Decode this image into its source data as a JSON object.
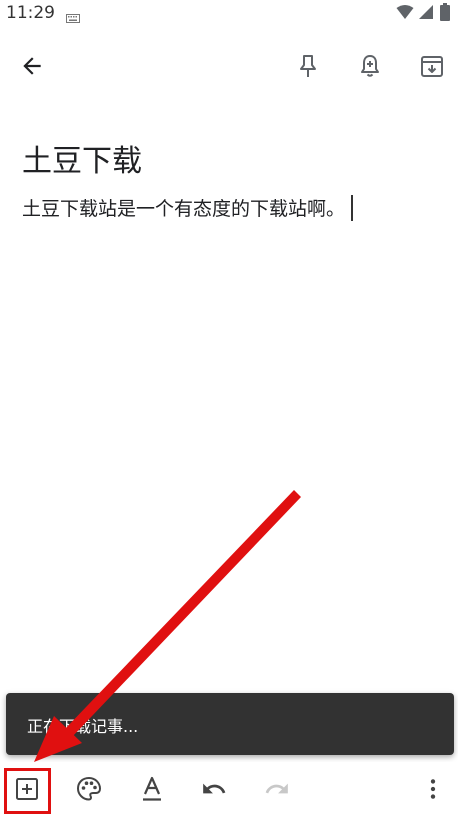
{
  "status_bar": {
    "time": "11:29",
    "icons": [
      "keyboard-icon",
      "wifi-icon",
      "signal-icon",
      "battery-icon"
    ]
  },
  "toolbar": {
    "back": "back-arrow-icon",
    "pin": "pin-icon",
    "reminder": "reminder-bell-icon",
    "archive": "archive-icon"
  },
  "note": {
    "title": "土豆下载",
    "body": "土豆下载站是一个有态度的下载站啊。"
  },
  "snackbar": {
    "message": "正在下载记事..."
  },
  "bottom_bar": {
    "icons": [
      "add-box-icon",
      "palette-icon",
      "text-format-icon",
      "undo-icon",
      "redo-icon",
      "more-vert-icon"
    ]
  },
  "annotation": {
    "color": "#e01010"
  },
  "colors": {
    "snackbar_bg": "#323232",
    "icon": "#5f6368",
    "redo_disabled": "#c8c8c8"
  }
}
